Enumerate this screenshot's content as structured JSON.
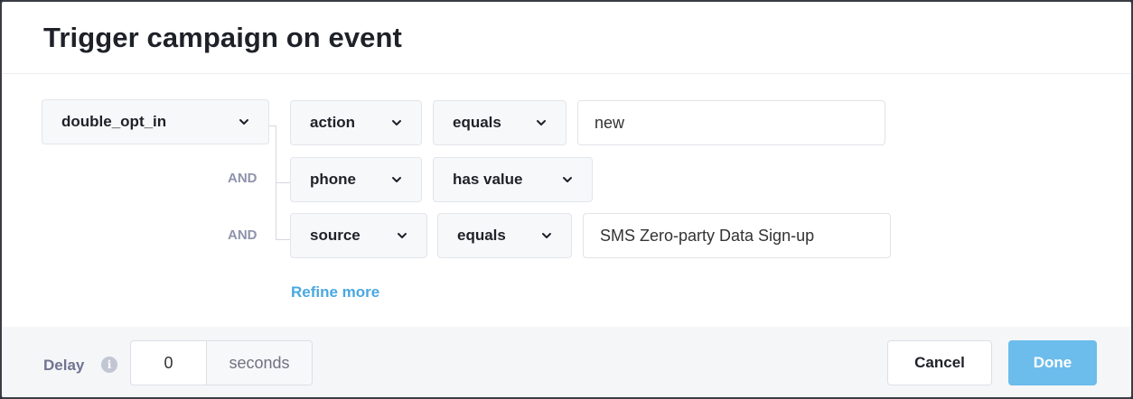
{
  "modal": {
    "title": "Trigger campaign on event"
  },
  "event_select": {
    "value": "double_opt_in"
  },
  "conditions": [
    {
      "prefix": "",
      "field": "action",
      "operator": "equals",
      "value": "new"
    },
    {
      "prefix": "AND",
      "field": "phone",
      "operator": "has value",
      "value": ""
    },
    {
      "prefix": "AND",
      "field": "source",
      "operator": "equals",
      "value": "SMS Zero-party Data Sign-up"
    }
  ],
  "refine_link": "Refine more",
  "footer": {
    "delay_label": "Delay",
    "info_icon": "i",
    "delay_value": "0",
    "delay_unit": "seconds",
    "cancel_label": "Cancel",
    "done_label": "Done"
  },
  "colors": {
    "accent": "#4aa8e0",
    "done_button": "#6cbcec",
    "and_label": "#8e93ad"
  },
  "icons": [
    "chevron-down-icon",
    "info-icon"
  ]
}
